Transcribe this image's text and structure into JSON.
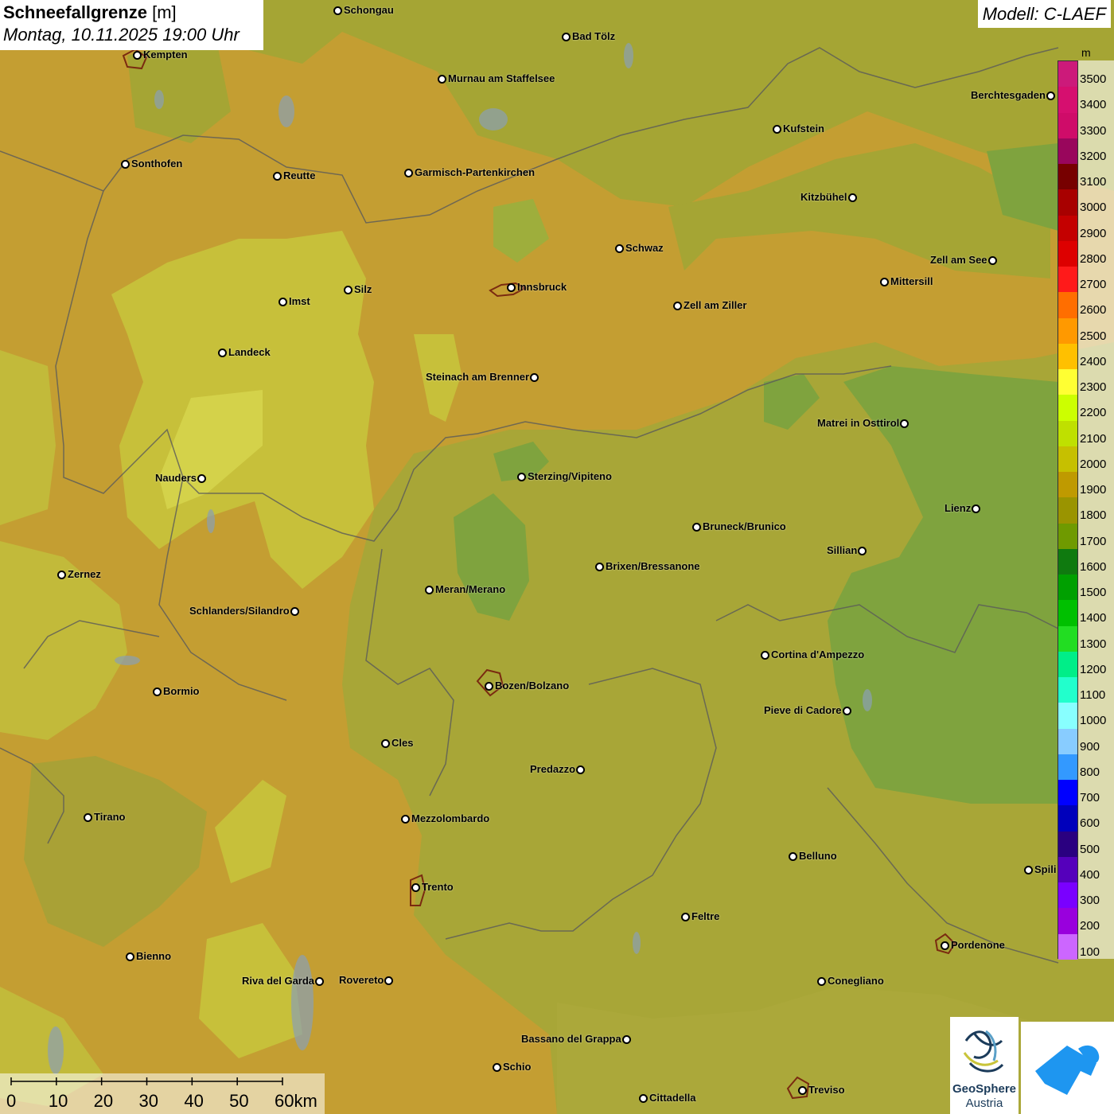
{
  "title": {
    "main": "Schneefallgrenze",
    "unit": "[m]",
    "datetime": "Montag, 10.11.2025 19:00 Uhr"
  },
  "model": "Modell: C-LAEF",
  "legend": {
    "unit": "m",
    "labels": [
      "3500",
      "3400",
      "3300",
      "3200",
      "3100",
      "3000",
      "2900",
      "2800",
      "2700",
      "2600",
      "2500",
      "2400",
      "2300",
      "2200",
      "2100",
      "2000",
      "1900",
      "1800",
      "1700",
      "1600",
      "1500",
      "1400",
      "1300",
      "1200",
      "1100",
      "1000",
      "900",
      "800",
      "700",
      "600",
      "500",
      "400",
      "300",
      "200",
      "100"
    ],
    "colors": [
      "#cc1a7a",
      "#d60f6f",
      "#cf0c69",
      "#99065c",
      "#770000",
      "#a80000",
      "#c40000",
      "#dd0000",
      "#ff1a1a",
      "#ff6e00",
      "#ff9900",
      "#ffc000",
      "#ffff33",
      "#ccff00",
      "#bfe000",
      "#c6c000",
      "#bf9a00",
      "#9a9400",
      "#6f9a00",
      "#0f7a0f",
      "#00a000",
      "#00c000",
      "#22dd22",
      "#00ee88",
      "#22ffcc",
      "#88ffff",
      "#88ccff",
      "#3399ff",
      "#0000ff",
      "#0000bb",
      "#2a0080",
      "#5500bb",
      "#7a00ff",
      "#9900dd",
      "#cc66ff"
    ]
  },
  "cities": [
    {
      "name": "Schongau",
      "label_side": "right"
    },
    {
      "name": "Bad Tölz",
      "label_side": "right"
    },
    {
      "name": "Kempten",
      "label_side": "right"
    },
    {
      "name": "Murnau am Staffelsee",
      "label_side": "right"
    },
    {
      "name": "Berchtesgaden",
      "label_side": "left"
    },
    {
      "name": "Kufstein",
      "label_side": "right"
    },
    {
      "name": "Sonthofen",
      "label_side": "right"
    },
    {
      "name": "Reutte",
      "label_side": "right"
    },
    {
      "name": "Garmisch-Partenkirchen",
      "label_side": "right"
    },
    {
      "name": "Kitzbühel",
      "label_side": "left"
    },
    {
      "name": "Schwaz",
      "label_side": "right"
    },
    {
      "name": "Zell am See",
      "label_side": "left"
    },
    {
      "name": "Innsbruck",
      "label_side": "right"
    },
    {
      "name": "Mittersill",
      "label_side": "right"
    },
    {
      "name": "Silz",
      "label_side": "right"
    },
    {
      "name": "Imst",
      "label_side": "right"
    },
    {
      "name": "Zell am Ziller",
      "label_side": "right"
    },
    {
      "name": "Landeck",
      "label_side": "right"
    },
    {
      "name": "Steinach am Brenner",
      "label_side": "left"
    },
    {
      "name": "Matrei in Osttirol",
      "label_side": "left"
    },
    {
      "name": "Nauders",
      "label_side": "left"
    },
    {
      "name": "Sterzing/Vipiteno",
      "label_side": "right"
    },
    {
      "name": "Lienz",
      "label_side": "left"
    },
    {
      "name": "Bruneck/Brunico",
      "label_side": "right"
    },
    {
      "name": "Sillian",
      "label_side": "left"
    },
    {
      "name": "Brixen/Bressanone",
      "label_side": "right"
    },
    {
      "name": "Zernez",
      "label_side": "right"
    },
    {
      "name": "Meran/Merano",
      "label_side": "right"
    },
    {
      "name": "Schlanders/Silandro",
      "label_side": "left"
    },
    {
      "name": "Cortina d'Ampezzo",
      "label_side": "right"
    },
    {
      "name": "Bozen/Bolzano",
      "label_side": "right"
    },
    {
      "name": "Bormio",
      "label_side": "right"
    },
    {
      "name": "Pieve di Cadore",
      "label_side": "left"
    },
    {
      "name": "Cles",
      "label_side": "right"
    },
    {
      "name": "Predazzo",
      "label_side": "left"
    },
    {
      "name": "Tirano",
      "label_side": "right"
    },
    {
      "name": "Mezzolombardo",
      "label_side": "right"
    },
    {
      "name": "Belluno",
      "label_side": "right"
    },
    {
      "name": "Spili",
      "label_side": "right"
    },
    {
      "name": "Trento",
      "label_side": "right"
    },
    {
      "name": "Feltre",
      "label_side": "right"
    },
    {
      "name": "Pordenone",
      "label_side": "right"
    },
    {
      "name": "Bienno",
      "label_side": "right"
    },
    {
      "name": "Riva del Garda",
      "label_side": "left"
    },
    {
      "name": "Rovereto",
      "label_side": "left"
    },
    {
      "name": "Conegliano",
      "label_side": "right"
    },
    {
      "name": "Bassano del Grappa",
      "label_side": "left"
    },
    {
      "name": "Schio",
      "label_side": "right"
    },
    {
      "name": "Treviso",
      "label_side": "right"
    },
    {
      "name": "Cittadella",
      "label_side": "right"
    }
  ],
  "scale": {
    "labels": [
      "0",
      "10",
      "20",
      "30",
      "40",
      "50",
      "60km"
    ]
  },
  "logos": {
    "geosphere_name": "GeoSphere",
    "geosphere_sub": "Austria",
    "geosphere_icon": "geosphere-logo-icon",
    "app_icon": "warnapp-logo-icon"
  }
}
